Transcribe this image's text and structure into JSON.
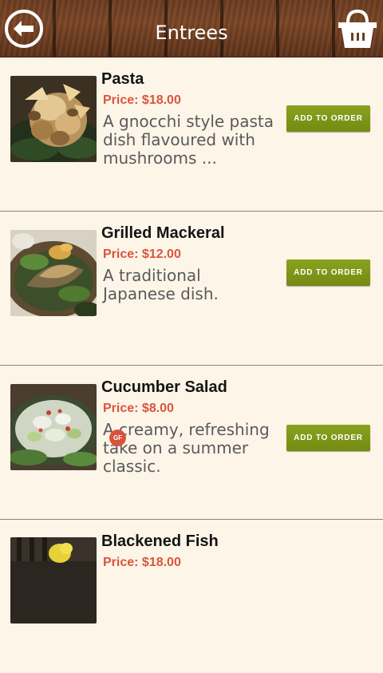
{
  "header": {
    "title": "Entrees",
    "back_icon": "back-arrow-icon",
    "basket_icon": "basket-icon"
  },
  "items": [
    {
      "name": "Pasta",
      "price": "Price: $18.00",
      "description": "A gnocchi style pasta dish flavoured with mushrooms ...",
      "button_label": "ADD TO ORDER"
    },
    {
      "name": "Grilled Mackeral",
      "price": "Price: $12.00",
      "description": "A traditional Japanese dish.",
      "button_label": "ADD TO ORDER"
    },
    {
      "name": "Cucumber Salad",
      "price": "Price: $8.00",
      "description": "A creamy, refreshing take on a summer classic.",
      "button_label": "ADD TO ORDER",
      "badge": "GF"
    },
    {
      "name": "Blackened Fish",
      "price": "Price: $18.00"
    }
  ],
  "colors": {
    "background": "#fdf5e8",
    "price": "#d9553e",
    "button": "#7d9418",
    "badge": "#d9533b",
    "header_wood": "#6b3d22"
  }
}
